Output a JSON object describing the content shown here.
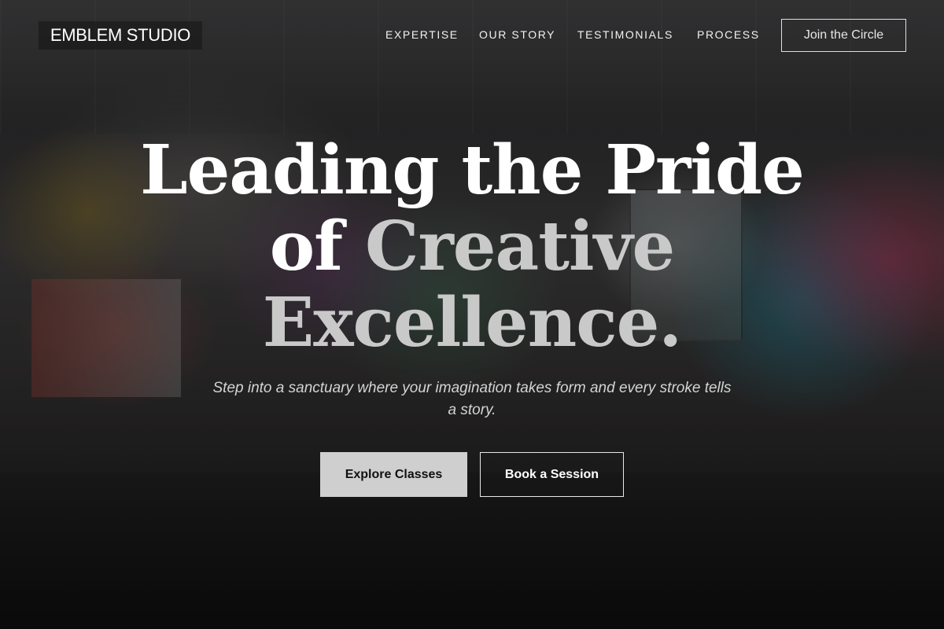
{
  "brand": {
    "name": "EMBLEM STUDIO"
  },
  "nav": {
    "links": [
      {
        "label": "EXPERTISE"
      },
      {
        "label": "OUR STORY"
      },
      {
        "label": "TESTIMONIALS"
      },
      {
        "label": "PROCESS"
      }
    ],
    "cta_label": "Join the Circle"
  },
  "hero": {
    "headline_line1": "Leading the Pride",
    "headline_line2_a": "of ",
    "headline_line2_b": "Creative",
    "headline_line3": "Excellence.",
    "subtitle": "Step into a sanctuary where your imagination takes form and every stroke tells a story.",
    "primary_cta": "Explore Classes",
    "secondary_cta": "Book a Session",
    "background_image": "graffiti-art-studio-photo"
  },
  "colors": {
    "text_primary": "#ffffff",
    "text_dimmed": "#c9c9c9",
    "primary_button_bg": "#cfcfcf",
    "overlay": "rgba(0,0,0,0.42)"
  }
}
